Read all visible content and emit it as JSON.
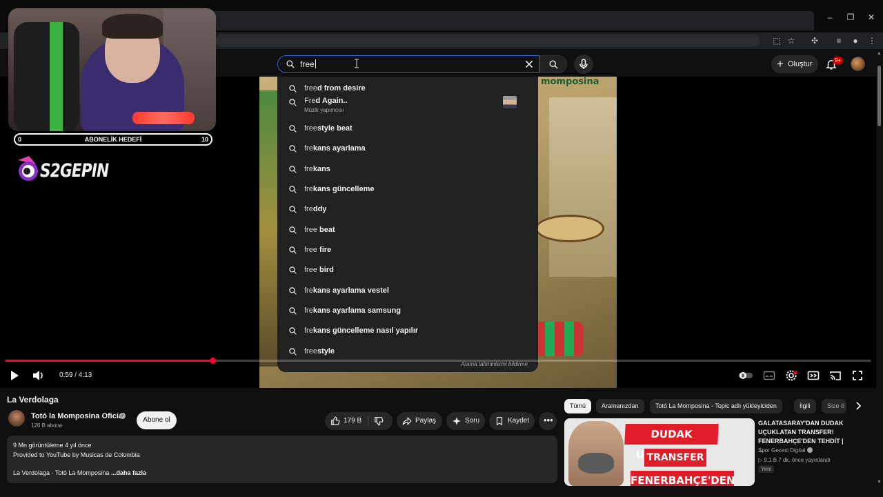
{
  "browser": {
    "minimize": "–",
    "restore": "❐",
    "close": "✕"
  },
  "masthead": {
    "search_query": "free",
    "create_label": "Oluştur",
    "notif_badge": "9+"
  },
  "overlay": {
    "goal_start": "0",
    "goal_label": "ABONELİK HEDEFİ",
    "goal_end": "10",
    "brand": "S2GEPIN"
  },
  "album": {
    "title": "momposina"
  },
  "suggestions": [
    {
      "pre": "free",
      "rest": "d from desire"
    },
    {
      "pre": "Fre",
      "rest": "d Again..",
      "sub": "Müzik yapımcısı"
    },
    {
      "pre": "free",
      "rest": "style beat"
    },
    {
      "pre": "fre",
      "rest": "kans ayarlama"
    },
    {
      "pre": "fre",
      "rest": "kans"
    },
    {
      "pre": "fre",
      "rest": "kans güncelleme"
    },
    {
      "pre": "fre",
      "rest": "ddy"
    },
    {
      "pre": "free",
      "rest": " beat"
    },
    {
      "pre": "free",
      "rest": " fire"
    },
    {
      "pre": "free",
      "rest": " bird"
    },
    {
      "pre": "fre",
      "rest": "kans ayarlama vestel"
    },
    {
      "pre": "fre",
      "rest": "kans ayarlama samsung"
    },
    {
      "pre": "fre",
      "rest": "kans güncelleme nasıl yapılır"
    },
    {
      "pre": "free",
      "rest": "style"
    }
  ],
  "report_text": "Arama tahminlerini bildirme",
  "player": {
    "time": "0:59 / 4:13",
    "progress": 0.239
  },
  "video": {
    "title": "La Verdolaga",
    "channel": "Totó la Momposina Oficial",
    "subs": "126 B abone",
    "subscribe": "Abone ol",
    "likes": "179 B",
    "share": "Paylaş",
    "ask": "Soru",
    "save": "Kaydet"
  },
  "description": {
    "stats": "9 Mn görüntüleme  4 yıl önce",
    "line2": "Provided to YouTube by Musicas de Colombia",
    "line3": "La Verdolaga · Totó La Momposina",
    "more": "...daha fazla"
  },
  "chips": [
    "Tümü",
    "Aramanızdan",
    "Totó La Momposina - Topic adlı yükleyiciden",
    "İlgili",
    "Size ö"
  ],
  "recommended": {
    "title": "GALATASARAY'DAN DUDAK UÇUKLATAN TRANSFER! FENERBAHÇE'DEN TEHDİT | ...",
    "channel": "Spor Gecesi Digital",
    "meta": "▷ 9,1 B  7 dk. önce yayınlandı",
    "badge": "Yeni",
    "thumb_line1": "DUDAK UÇUKLATAN",
    "thumb_line2": "TRANSFER ?",
    "thumb_line3": "FENERBAHÇE'DEN"
  },
  "colors": {
    "accent": "#ff0033",
    "search_border": "#3562c9",
    "background": "#0f0f0f"
  }
}
